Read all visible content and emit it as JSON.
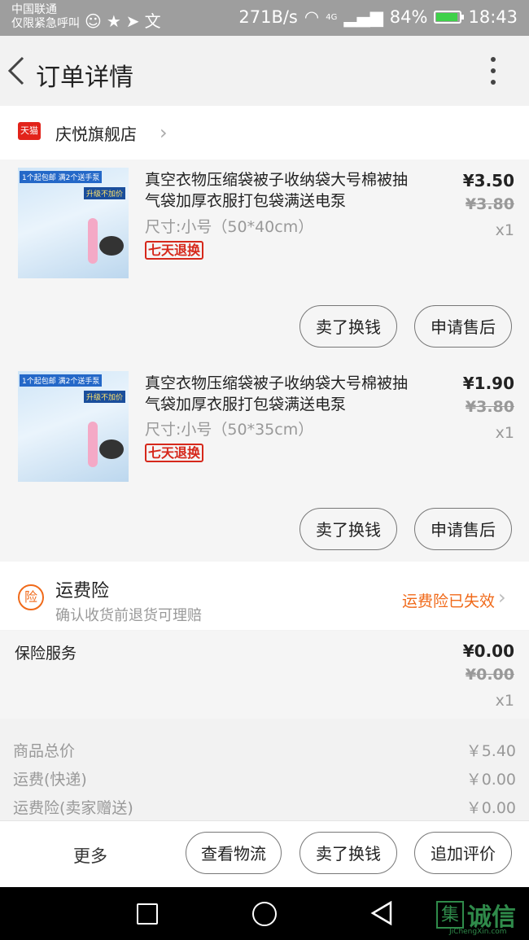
{
  "status_bar": {
    "carrier_line1": "中国联通",
    "carrier_line2": "仅限紧急呼叫",
    "speed": "271B/s",
    "network": "4G",
    "battery": "84%",
    "battery_level": 0.84,
    "time": "18:43"
  },
  "header": {
    "title": "订单详情"
  },
  "store": {
    "badge": "天猫",
    "name": "庆悦旗舰店"
  },
  "products": [
    {
      "thumb_tag1": "1个起包邮  满2个送手泵",
      "thumb_tag2": "升级不加价",
      "title": "真空衣物压缩袋被子收纳袋大号棉被抽气袋加厚衣服打包袋满送电泵",
      "spec": "尺寸:小号（50*40cm）",
      "badge": "七天退换",
      "price": "¥3.50",
      "original_price": "¥3.80",
      "qty": "x1",
      "btn_exchange": "卖了换钱",
      "btn_after_sale": "申请售后"
    },
    {
      "thumb_tag1": "1个起包邮  满2个送手泵",
      "thumb_tag2": "升级不加价",
      "title": "真空衣物压缩袋被子收纳袋大号棉被抽气袋加厚衣服打包袋满送电泵",
      "spec": "尺寸:小号（50*35cm）",
      "badge": "七天退换",
      "price": "¥1.90",
      "original_price": "¥3.80",
      "qty": "x1",
      "btn_exchange": "卖了换钱",
      "btn_after_sale": "申请售后"
    }
  ],
  "freight_insurance": {
    "icon_char": "险",
    "title": "运费险",
    "subtitle": "确认收货前退货可理赔",
    "status": "运费险已失效"
  },
  "insurance_service": {
    "label": "保险服务",
    "price": "¥0.00",
    "original_price": "¥0.00",
    "qty": "x1"
  },
  "summary": [
    {
      "label": "商品总价",
      "value": "￥5.40"
    },
    {
      "label": "运费(快递)",
      "value": "￥0.00"
    },
    {
      "label": "运费险(卖家赠送)",
      "value": "￥0.00"
    }
  ],
  "action_bar": {
    "more": "更多",
    "logistics": "查看物流",
    "exchange": "卖了换钱",
    "review": "追加评价"
  },
  "watermark": {
    "box_char": "集",
    "text": "诚信",
    "url": "JiChengXin.com"
  },
  "colors": {
    "accent": "#f06a1a",
    "badge_red": "#d6281b",
    "tmall_red": "#e2231a"
  }
}
